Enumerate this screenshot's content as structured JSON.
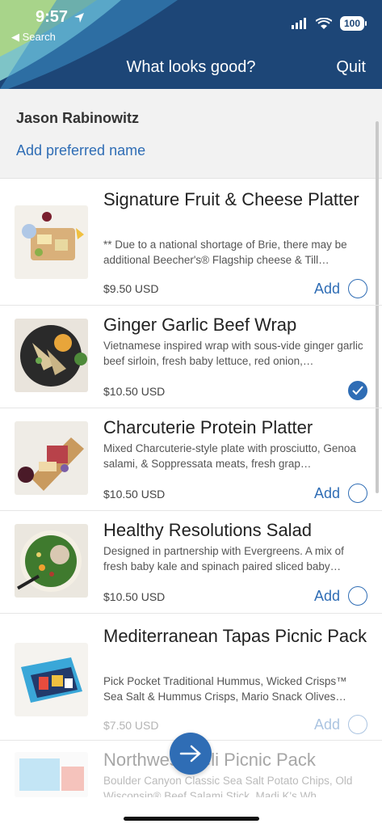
{
  "status_bar": {
    "time": "9:57",
    "back_label": "◀ Search",
    "battery": "100"
  },
  "nav": {
    "title": "What looks good?",
    "quit_label": "Quit"
  },
  "profile": {
    "name": "Jason Rabinowitz",
    "preferred_name_link": "Add preferred name"
  },
  "items": [
    {
      "title": "Signature Fruit & Cheese Platter",
      "description": "** Due to a national shortage of Brie, there may be additional Beecher's® Flagship cheese & Till…",
      "price": "$9.50 USD",
      "add_label": "Add",
      "selected": false
    },
    {
      "title": "Ginger Garlic Beef Wrap",
      "description": "Vietnamese inspired wrap with sous-vide ginger garlic beef sirloin, fresh baby lettuce, red onion,…",
      "price": "$10.50 USD",
      "add_label": "",
      "selected": true
    },
    {
      "title": "Charcuterie Protein Platter",
      "description": "Mixed Charcuterie-style plate with prosciutto, Genoa salami, & Soppressata meats, fresh grap…",
      "price": "$10.50 USD",
      "add_label": "Add",
      "selected": false
    },
    {
      "title": "Healthy Resolutions Salad",
      "description": "Designed in partnership with Evergreens. A mix of fresh baby kale and spinach paired sliced baby…",
      "price": "$10.50 USD",
      "add_label": "Add",
      "selected": false
    },
    {
      "title": "Mediterranean Tapas Picnic Pack",
      "description": "Pick Pocket Traditional Hummus, Wicked Crisps™ Sea Salt & Hummus Crisps, Mario Snack Olives…",
      "price": "$7.50 USD",
      "add_label": "Add",
      "selected": false
    },
    {
      "title": "Northwest Deli Picnic Pack",
      "description": "Boulder Canyon Classic Sea Salt Potato Chips, Old Wisconsin® Beef Salami Stick, Madi K's Wh…",
      "price": "",
      "add_label": "",
      "selected": false
    }
  ],
  "colors": {
    "header": "#1d4677",
    "accent": "#2f6db5"
  }
}
